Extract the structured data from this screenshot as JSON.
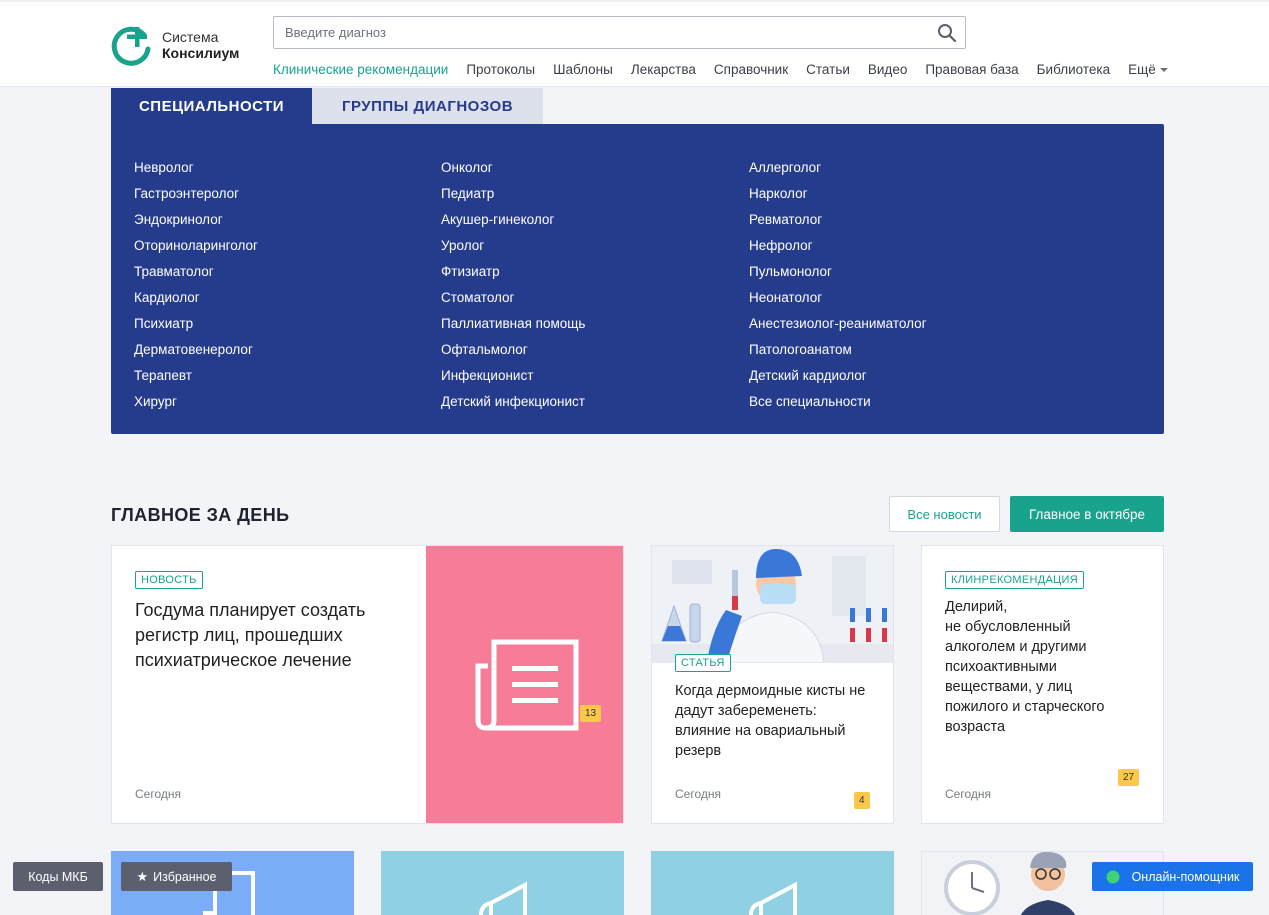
{
  "logo": {
    "line1": "Система",
    "line2": "Консилиум"
  },
  "search": {
    "placeholder": "Введите диагноз"
  },
  "nav": {
    "items": [
      "Клинические рекомендации",
      "Протоколы",
      "Шаблоны",
      "Лекарства",
      "Справочник",
      "Статьи",
      "Видео",
      "Правовая база",
      "Библиотека"
    ],
    "more": "Ещё"
  },
  "tabs": {
    "specialties": "СПЕЦИАЛЬНОСТИ",
    "groups": "ГРУППЫ ДИАГНОЗОВ"
  },
  "specialties": {
    "col1": [
      "Невролог",
      "Гастроэнтеролог",
      "Эндокринолог",
      "Оториноларинголог",
      "Травматолог",
      "Кардиолог",
      "Психиатр",
      "Дерматовенеролог",
      "Терапевт",
      "Хирург"
    ],
    "col2": [
      "Онколог",
      "Педиатр",
      "Акушер-гинеколог",
      "Уролог",
      "Фтизиатр",
      "Стоматолог",
      "Паллиативная помощь",
      "Офтальмолог",
      "Инфекционист",
      "Детский инфекционист"
    ],
    "col3": [
      "Аллерголог",
      "Нарколог",
      "Ревматолог",
      "Нефролог",
      "Пульмонолог",
      "Неонатолог",
      "Анестезиолог-реаниматолог",
      "Патологоанатом",
      "Детский кардиолог",
      "Все специальности"
    ]
  },
  "news": {
    "title": "ГЛАВНОЕ ЗА ДЕНЬ",
    "btn_all": "Все новости",
    "btn_month": "Главное в октябре",
    "cards": [
      {
        "tag": "НОВОСТЬ",
        "title": "Госдума планирует создать регистр лиц, прошедших психиатрическое лечение",
        "date": "Сегодня",
        "count": "13"
      },
      {
        "tag": "СТАТЬЯ",
        "title": "Когда дермоидные кисты не дадут забеременеть: влияние на овариальный резерв",
        "date": "Сегодня",
        "count": "4"
      },
      {
        "tag": "КЛИНРЕКОМЕНДАЦИЯ",
        "title_lines": [
          "Делирий,",
          "не обусловленный",
          "алкоголем и другими",
          "психоактивными",
          "веществами, у лиц",
          "пожилого и старческого",
          "возраста"
        ],
        "date": "Сегодня",
        "count": "27"
      }
    ]
  },
  "floating": {
    "mkb": "Коды МКБ",
    "favorites": "Избранное",
    "assistant": "Онлайн-помощник"
  },
  "colors": {
    "primary": "#253b8c",
    "accent": "#19a38d",
    "pink": "#f77c98",
    "badge": "#fcc84a",
    "assistant": "#1a73e8"
  }
}
